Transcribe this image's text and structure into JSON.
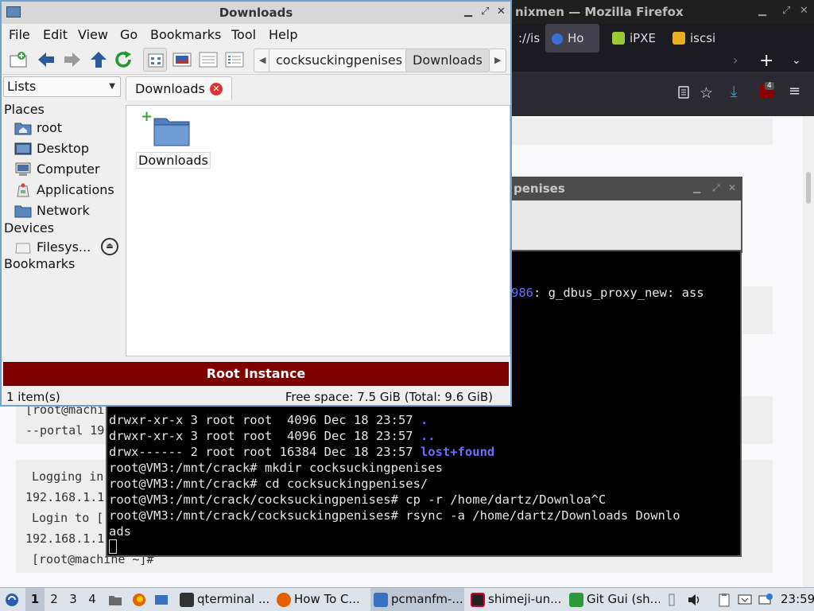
{
  "firefox": {
    "title": "nixmen — Mozilla Firefox",
    "tabs": [
      {
        "label": "://is",
        "active": false
      },
      {
        "label": "Ho",
        "active": true
      },
      {
        "label": "iPXE",
        "active": false
      },
      {
        "label": "iscsi",
        "active": false
      }
    ],
    "badge_count": "4",
    "page_lines": [
      "[root@machi",
      "--portal 19",
      "Logging in",
      "192.168.1.1",
      "Login to [",
      "192.168.1.1",
      "[root@machine ~]#"
    ]
  },
  "inner_window": {
    "title": "penises"
  },
  "terminal": {
    "partial_line_prefix": "986",
    "partial_line_rest": ": g_dbus_proxy_new: ass",
    "ls_lines": [
      {
        "perm": "drwxr-xr-x 3 root root  4096 Dec 18 23:57 ",
        "name": "."
      },
      {
        "perm": "drwxr-xr-x 3 root root  4096 Dec 18 23:57 ",
        "name": ".."
      },
      {
        "perm": "drwx------ 2 root root 16384 Dec 18 23:57 ",
        "name": "lost+found"
      }
    ],
    "cmd_lines": [
      "root@VM3:/mnt/crack# mkdir cocksuckingpenises",
      "root@VM3:/mnt/crack# cd cocksuckingpenises/",
      "root@VM3:/mnt/crack/cocksuckingpenises# cp -r /home/dartz/Downloa^C",
      "root@VM3:/mnt/crack/cocksuckingpenises# rsync -a /home/dartz/Downloads Downlo",
      "ads"
    ]
  },
  "filemanager": {
    "title": "Downloads",
    "menu": [
      "File",
      "Edit",
      "View",
      "Go",
      "Bookmarks",
      "Tool",
      "Help"
    ],
    "breadcrumbs": [
      "cocksuckingpenises",
      "Downloads"
    ],
    "side_selector": "Lists",
    "sections": {
      "places": "Places",
      "devices": "Devices",
      "bookmarks": "Bookmarks"
    },
    "places": [
      "root",
      "Desktop",
      "Computer",
      "Applications",
      "Network"
    ],
    "devices": [
      "Filesys..."
    ],
    "tab_label": "Downloads",
    "file_name": "Downloads",
    "root_banner": "Root Instance",
    "status_left": "1 item(s)",
    "status_right": "Free space: 7.5 GiB (Total: 9.6 GiB)"
  },
  "taskbar": {
    "workspaces": [
      "1",
      "2",
      "3",
      "4"
    ],
    "tasks": [
      "qterminal ...",
      "How To C...",
      "pcmanfm-...",
      "shimeji-un...",
      "Git Gui (sh..."
    ],
    "clock": "23:59"
  }
}
